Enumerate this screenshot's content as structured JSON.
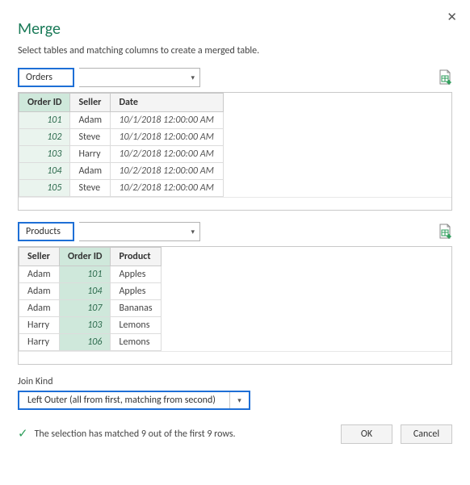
{
  "title": "Merge",
  "subtitle": "Select tables and matching columns to create a merged table.",
  "table1": {
    "name": "Orders",
    "columns": [
      "Order ID",
      "Seller",
      "Date"
    ],
    "selected_col_index": 0,
    "rows": [
      {
        "id": "101",
        "seller": "Adam",
        "date": "10/1/2018 12:00:00 AM"
      },
      {
        "id": "102",
        "seller": "Steve",
        "date": "10/1/2018 12:00:00 AM"
      },
      {
        "id": "103",
        "seller": "Harry",
        "date": "10/2/2018 12:00:00 AM"
      },
      {
        "id": "104",
        "seller": "Adam",
        "date": "10/2/2018 12:00:00 AM"
      },
      {
        "id": "105",
        "seller": "Steve",
        "date": "10/2/2018 12:00:00 AM"
      }
    ]
  },
  "table2": {
    "name": "Products",
    "columns": [
      "Seller",
      "Order ID",
      "Product"
    ],
    "selected_col_index": 1,
    "rows": [
      {
        "seller": "Adam",
        "id": "101",
        "product": "Apples"
      },
      {
        "seller": "Adam",
        "id": "104",
        "product": "Apples"
      },
      {
        "seller": "Adam",
        "id": "107",
        "product": "Bananas"
      },
      {
        "seller": "Harry",
        "id": "103",
        "product": "Lemons"
      },
      {
        "seller": "Harry",
        "id": "106",
        "product": "Lemons"
      }
    ]
  },
  "join_kind": {
    "label": "Join Kind",
    "value": "Left Outer (all from first, matching from second)"
  },
  "status": "The selection has matched 9 out of the first 9 rows.",
  "buttons": {
    "ok": "OK",
    "cancel": "Cancel"
  }
}
